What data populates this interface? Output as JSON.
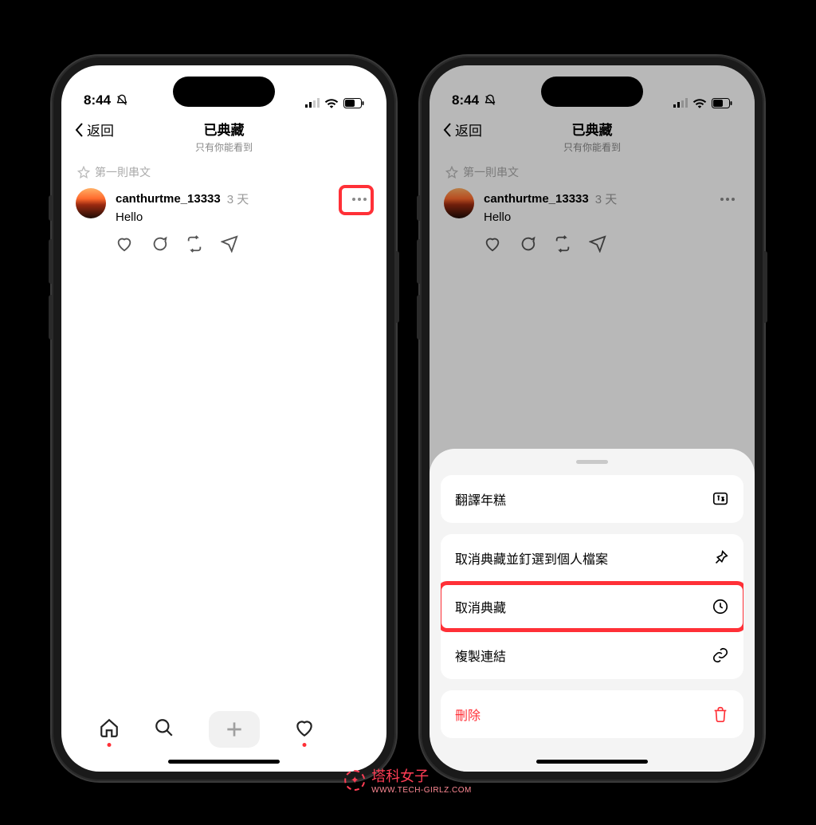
{
  "status": {
    "time": "8:44"
  },
  "header": {
    "back_label": "返回",
    "title": "已典藏",
    "subtitle": "只有你能看到"
  },
  "tag": {
    "label": "第一則串文"
  },
  "post": {
    "username": "canthurtme_13333",
    "time": "3 天",
    "text": "Hello"
  },
  "sheet": {
    "translate": "翻譯年糕",
    "unarchive_pin": "取消典藏並釘選到個人檔案",
    "unarchive": "取消典藏",
    "copy_link": "複製連結",
    "delete": "刪除"
  },
  "watermark": {
    "name": "塔科女子",
    "url": "WWW.TECH-GIRLZ.COM"
  }
}
